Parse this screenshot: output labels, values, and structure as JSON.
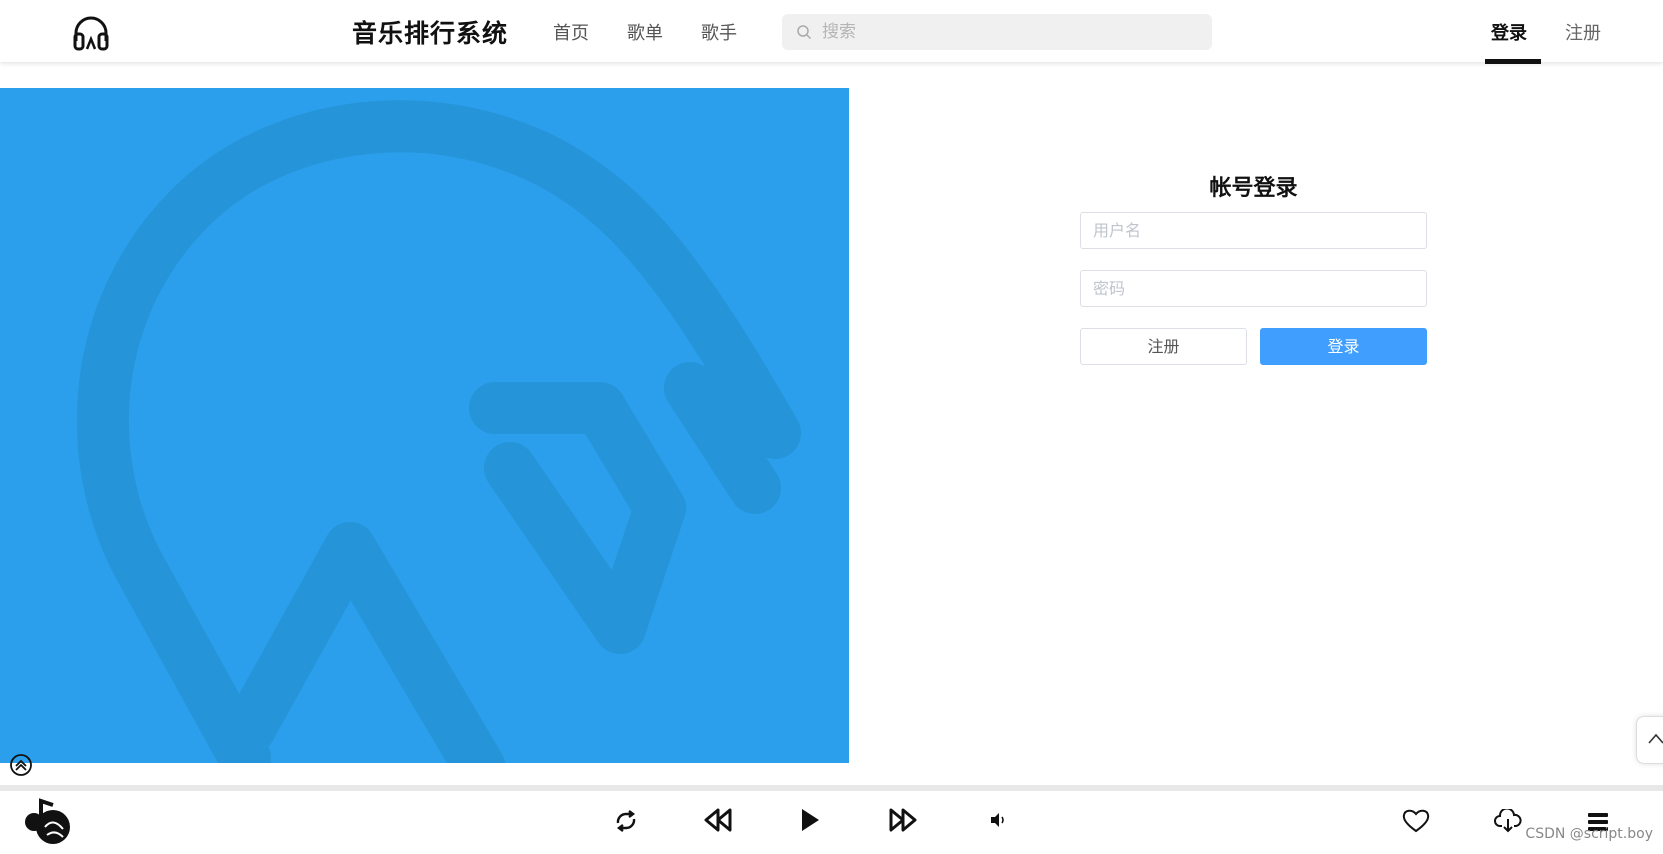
{
  "header": {
    "app_title": "音乐排行系统",
    "nav": [
      "首页",
      "歌单",
      "歌手"
    ],
    "search_placeholder": "搜索",
    "login_link": "登录",
    "register_link": "注册"
  },
  "login_form": {
    "title": "帐号登录",
    "username_placeholder": "用户名",
    "password_placeholder": "密码",
    "register_button": "注册",
    "login_button": "登录"
  },
  "colors": {
    "banner": "#2b9fec",
    "primary_button": "#409eff"
  },
  "player": {
    "icons": [
      "music-note-logo-icon",
      "loop-icon",
      "previous-icon",
      "play-icon",
      "next-icon",
      "volume-icon",
      "heart-icon",
      "download-cloud-icon",
      "playlist-menu-icon"
    ]
  },
  "watermark": "CSDN @script.boy"
}
